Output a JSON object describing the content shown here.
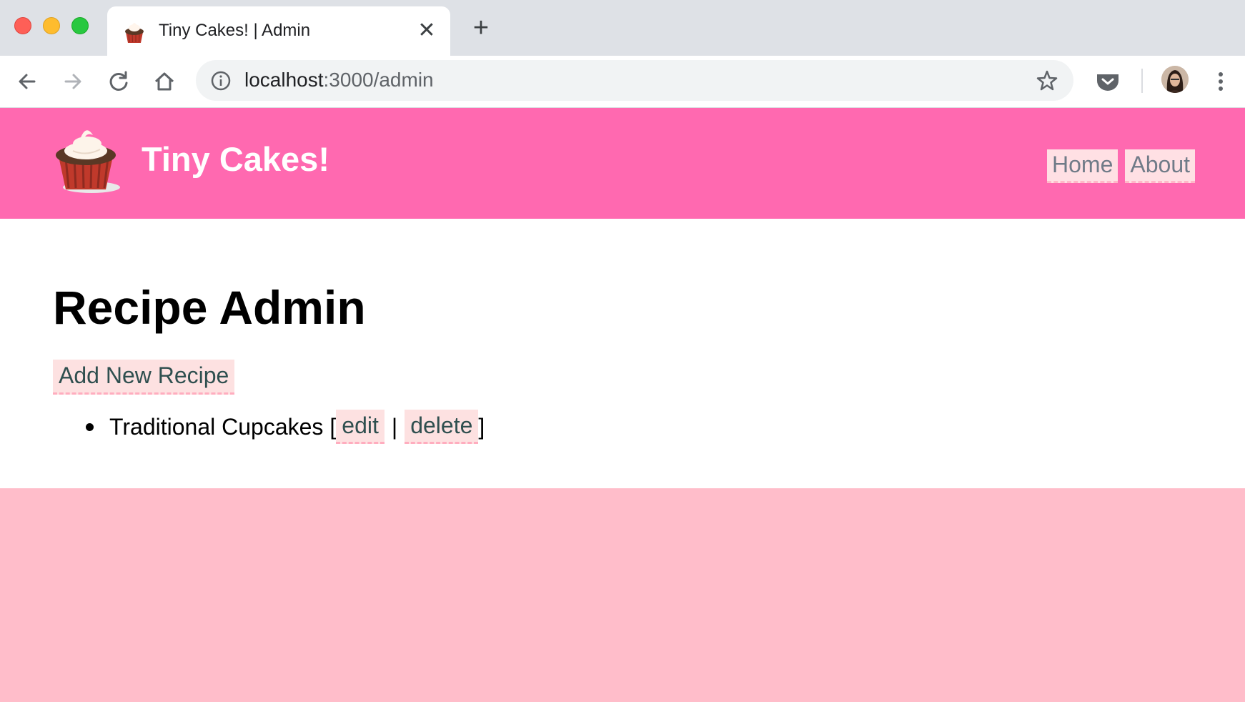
{
  "browser": {
    "tab": {
      "title": "Tiny Cakes! | Admin",
      "close_glyph": "✕"
    },
    "new_tab_glyph": "+",
    "url": {
      "host": "localhost",
      "path": ":3000/admin"
    },
    "icons": {
      "back": "back-arrow-icon",
      "forward": "forward-arrow-icon",
      "reload": "reload-icon",
      "home": "home-icon",
      "info": "info-icon",
      "bookmark": "star-icon",
      "pocket": "pocket-icon",
      "menu": "kebab-menu-icon"
    }
  },
  "site": {
    "title": "Tiny Cakes!",
    "nav": [
      {
        "label": "Home"
      },
      {
        "label": "About"
      }
    ],
    "colors": {
      "header": "#ff69b0",
      "footer": "#ffbdca",
      "link_bg": "#fde1e1"
    }
  },
  "main": {
    "heading": "Recipe Admin",
    "add_link": "Add New Recipe",
    "recipes": [
      {
        "name": "Traditional Cupcakes",
        "open_bracket": "[",
        "edit_label": "edit",
        "separator": "|",
        "delete_label": "delete",
        "close_bracket": "]"
      }
    ]
  }
}
